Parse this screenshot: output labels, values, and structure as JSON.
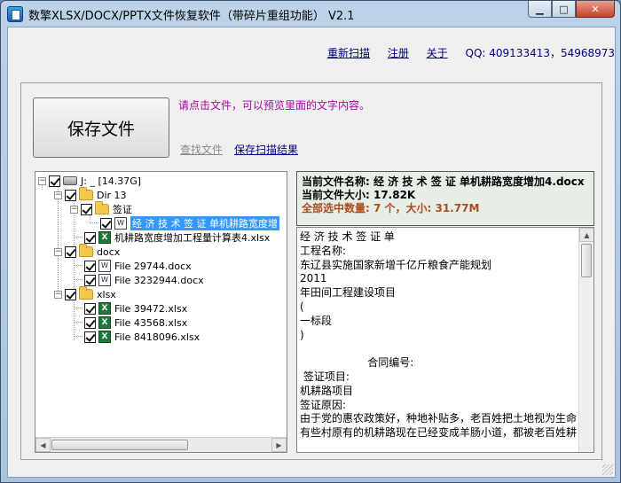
{
  "window": {
    "title": "数擎XLSX/DOCX/PPTX文件恢复软件（带碎片重组功能） V2.1",
    "min_symbol": "▁",
    "max_symbol": "□",
    "close_symbol": "✕"
  },
  "toplinks": {
    "rescan": "重新扫描",
    "register": "注册",
    "about": "关于",
    "qq": "QQ: 409133413，54968973"
  },
  "main": {
    "save_button": "保存文件",
    "hint": "请点击文件，可以预览里面的文字内容。",
    "find_file": "查找文件",
    "save_scan": "保存扫描结果"
  },
  "tree": {
    "items": [
      {
        "label": "J: _ [14.37G]"
      },
      {
        "label": "Dir 13"
      },
      {
        "label": "签证"
      },
      {
        "label": "经 济 技 术 签 证 单机耕路宽度增"
      },
      {
        "label": "机耕路宽度增加工程量计算表4.xlsx"
      },
      {
        "label": "docx"
      },
      {
        "label": "File 29744.docx"
      },
      {
        "label": "File 3232944.docx"
      },
      {
        "label": "xlsx"
      },
      {
        "label": "File 39472.xlsx"
      },
      {
        "label": "File 43568.xlsx"
      },
      {
        "label": "File 8418096.xlsx"
      }
    ]
  },
  "info": {
    "name_line": "当前文件名称: 经 济 技 术 签 证 单机耕路宽度增加4.docx",
    "size_line": "当前文件大小: 17.82K",
    "total_line": "全部选中数量: 7 个，大小: 31.77M"
  },
  "preview": {
    "text": "经 济 技 术 签 证 单\n工程名称:\n东辽县实施国家新增千亿斤粮食产能规划\n2011\n年田间工程建设项目\n(\n一标段\n)\n\n                    合同编号:\n 签证项目:\n机耕路项目\n签证原因:\n由于党的惠农政策好，种地补贴多，老百姓把土地视为生命\n有些村原有的机耕路现在已经变成羊肠小道，都被老百姓耕"
  }
}
